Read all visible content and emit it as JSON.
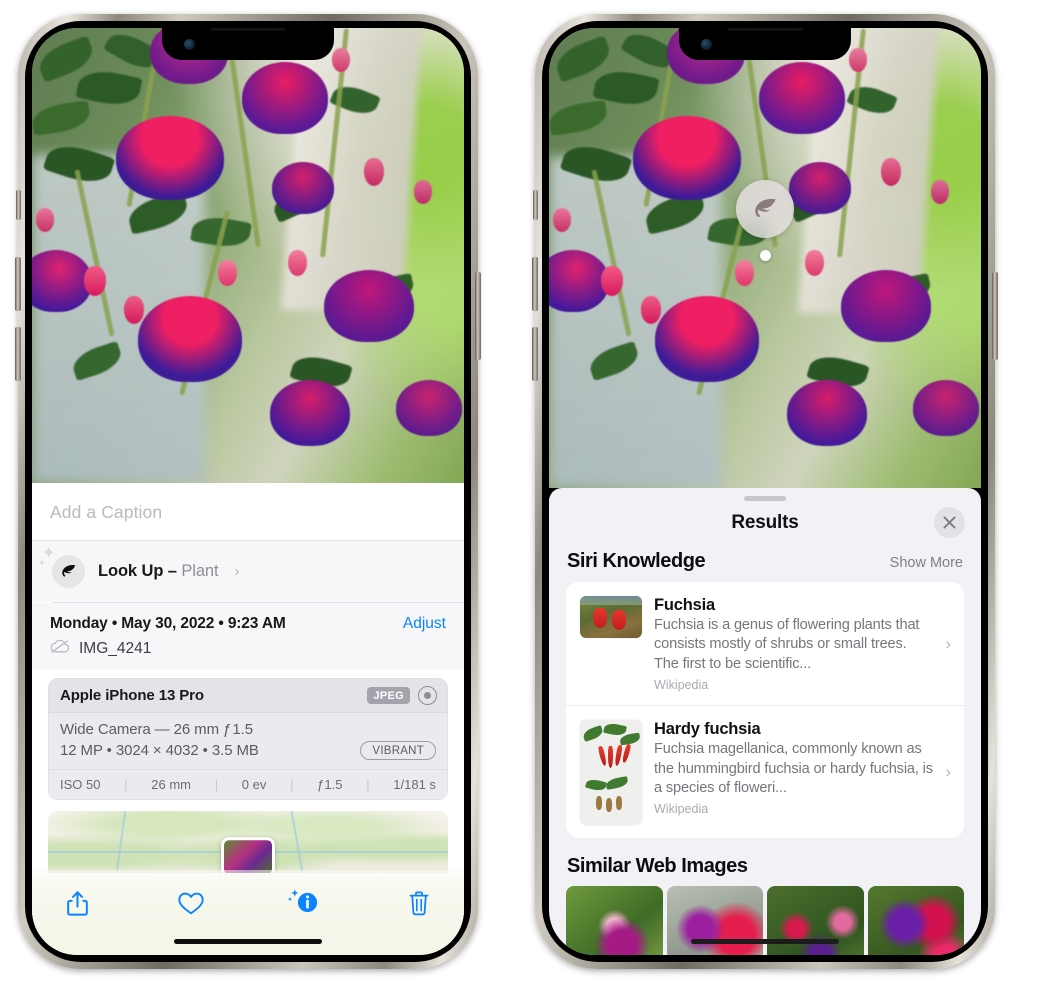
{
  "left_phone": {
    "caption": {
      "placeholder": "Add a Caption",
      "value": ""
    },
    "lookup": {
      "icon": "leaf-icon",
      "label": "Look Up",
      "dash": " – ",
      "subject": "Plant",
      "chevron": "›"
    },
    "meta": {
      "date": "Monday • May 30, 2022 • 9:23 AM",
      "adjust_label": "Adjust",
      "cloud_icon": "cloud-slash-icon",
      "filename": "IMG_4241"
    },
    "camera_card": {
      "device": "Apple iPhone 13 Pro",
      "format_tag": "JPEG",
      "aperture_icon": "aperture-icon",
      "lens_line": "Wide Camera — 26 mm ƒ 1.5",
      "specs_line": "12 MP • 3024 × 4032 • 3.5 MB",
      "style_tag": "VIBRANT",
      "exif": [
        "ISO 50",
        "26 mm",
        "0 ev",
        "ƒ1.5",
        "1/181 s"
      ]
    },
    "map": {
      "pin": "photo-pin"
    },
    "toolbar": [
      {
        "name": "share-button",
        "icon": "share-icon"
      },
      {
        "name": "favorite-button",
        "icon": "heart-icon"
      },
      {
        "name": "info-button",
        "icon": "info-sparkle-icon"
      },
      {
        "name": "delete-button",
        "icon": "trash-icon"
      }
    ]
  },
  "right_phone": {
    "badge": {
      "icon": "leaf-icon"
    },
    "sheet": {
      "title": "Results",
      "close_icon": "close-icon",
      "siri": {
        "heading": "Siri Knowledge",
        "show_more": "Show More",
        "items": [
          {
            "title": "Fuchsia",
            "description": "Fuchsia is a genus of flowering plants that consists mostly of shrubs or small trees. The first to be scientific...",
            "source": "Wikipedia",
            "chevron": "›"
          },
          {
            "title": "Hardy fuchsia",
            "description": "Fuchsia magellanica, commonly known as the hummingbird fuchsia or hardy fuchsia, is a species of floweri...",
            "source": "Wikipedia",
            "chevron": "›"
          }
        ]
      },
      "similar": {
        "heading": "Similar Web Images",
        "tiles": [
          "web-image-1",
          "web-image-2",
          "web-image-3",
          "web-image-4"
        ]
      }
    }
  },
  "colors": {
    "accent_blue": "#0a84ff",
    "sheet_bg": "#f2f1f6",
    "card_bg": "#ffffff",
    "secondary_text": "#8e8e93"
  }
}
